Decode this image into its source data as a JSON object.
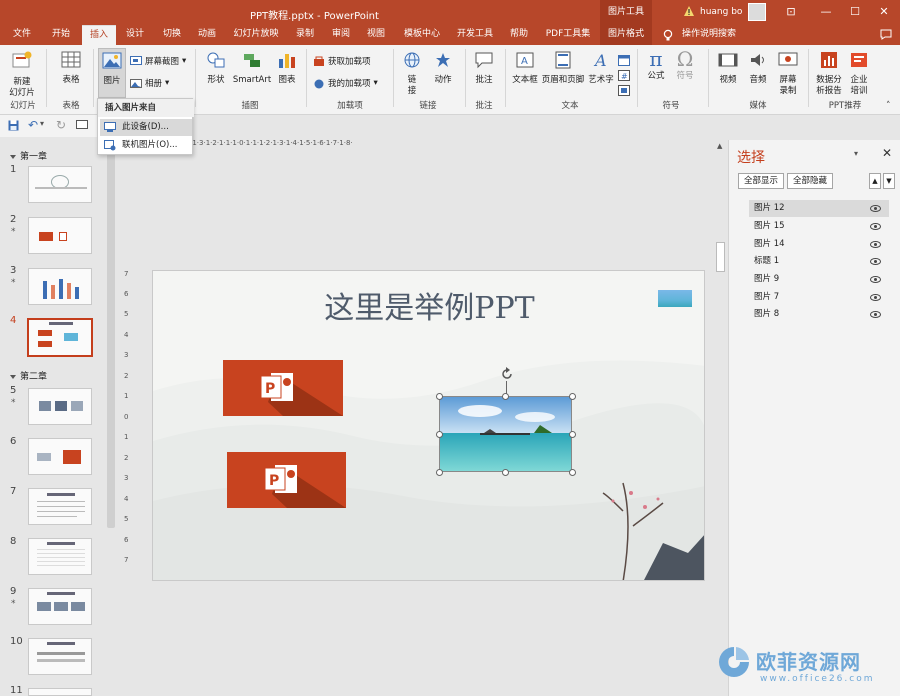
{
  "titlebar": {
    "file_title": "PPT教程.pptx  -  PowerPoint",
    "context_header": "图片工具",
    "user": "huang bo",
    "win_buttons": [
      "⊡",
      "—",
      "☐",
      "✕"
    ]
  },
  "tabs": [
    {
      "label": "文件"
    },
    {
      "label": "开始"
    },
    {
      "label": "插入"
    },
    {
      "label": "设计"
    },
    {
      "label": "切换"
    },
    {
      "label": "动画"
    },
    {
      "label": "幻灯片放映"
    },
    {
      "label": "录制"
    },
    {
      "label": "审阅"
    },
    {
      "label": "视图"
    },
    {
      "label": "模板中心"
    },
    {
      "label": "开发工具"
    },
    {
      "label": "帮助"
    },
    {
      "label": "PDF工具集"
    },
    {
      "label": "图片格式"
    },
    {
      "label": "操作说明搜索"
    }
  ],
  "ribbon": {
    "new_slide": "新建\n幻灯片",
    "table": "表格",
    "picture": "图片",
    "screenshot": "屏幕截图",
    "album": "相册",
    "shapes": "形状",
    "smartart": "SmartArt",
    "chart": "图表",
    "get_addins": "获取加载项",
    "my_addins": "我的加载项",
    "link": "链\n接",
    "action": "动作",
    "comment": "批注",
    "textbox": "文本框",
    "header_footer": "页眉和页脚",
    "wordart": "艺术字",
    "formula": "公式",
    "symbol": "符号",
    "video": "视频",
    "audio": "音频",
    "screen_record": "屏幕\n录制",
    "data_report": "数据分\n析报告",
    "enterprise_training": "企业\n培训",
    "groups": {
      "slides": "幻灯片",
      "tables": "表格",
      "illustrations": "插图",
      "addins": "加载项",
      "links": "链接",
      "comments": "批注",
      "text": "文本",
      "symbols": "符号",
      "media": "媒体",
      "ppt_recommend": "PPT推荐"
    }
  },
  "dropdown": {
    "header": "插入图片来自",
    "items": [
      "此设备(D)...",
      "联机图片(O)..."
    ]
  },
  "slidepane": {
    "section1": "第一章",
    "section2": "第二章",
    "numbers": [
      "1",
      "2",
      "3",
      "4",
      "5",
      "6",
      "7",
      "8",
      "9",
      "10",
      "11"
    ]
  },
  "ruler_h": "·8·1·7·1·6·1·5·1·4·1·3·1·2·1·1·1·0·1·1·1·2·1·3·1·4·1·5·1·6·1·7·1·8·",
  "ruler_v": [
    "7",
    "6",
    "5",
    "4",
    "3",
    "2",
    "1",
    "0",
    "1",
    "2",
    "3",
    "4",
    "5",
    "6",
    "7"
  ],
  "slide": {
    "title": "这里是举例PPT"
  },
  "selection_pane": {
    "title": "选择",
    "show_all": "全部显示",
    "hide_all": "全部隐藏",
    "items": [
      "图片 12",
      "图片 15",
      "图片 14",
      "标题 1",
      "图片 9",
      "图片 7",
      "图片 8"
    ]
  },
  "watermark": {
    "text": "欧菲资源网",
    "url": "www.office26.com"
  },
  "colors": {
    "accent": "#b7472a",
    "ppt_orange": "#c8431f",
    "selection_title": "#c43e1c"
  }
}
